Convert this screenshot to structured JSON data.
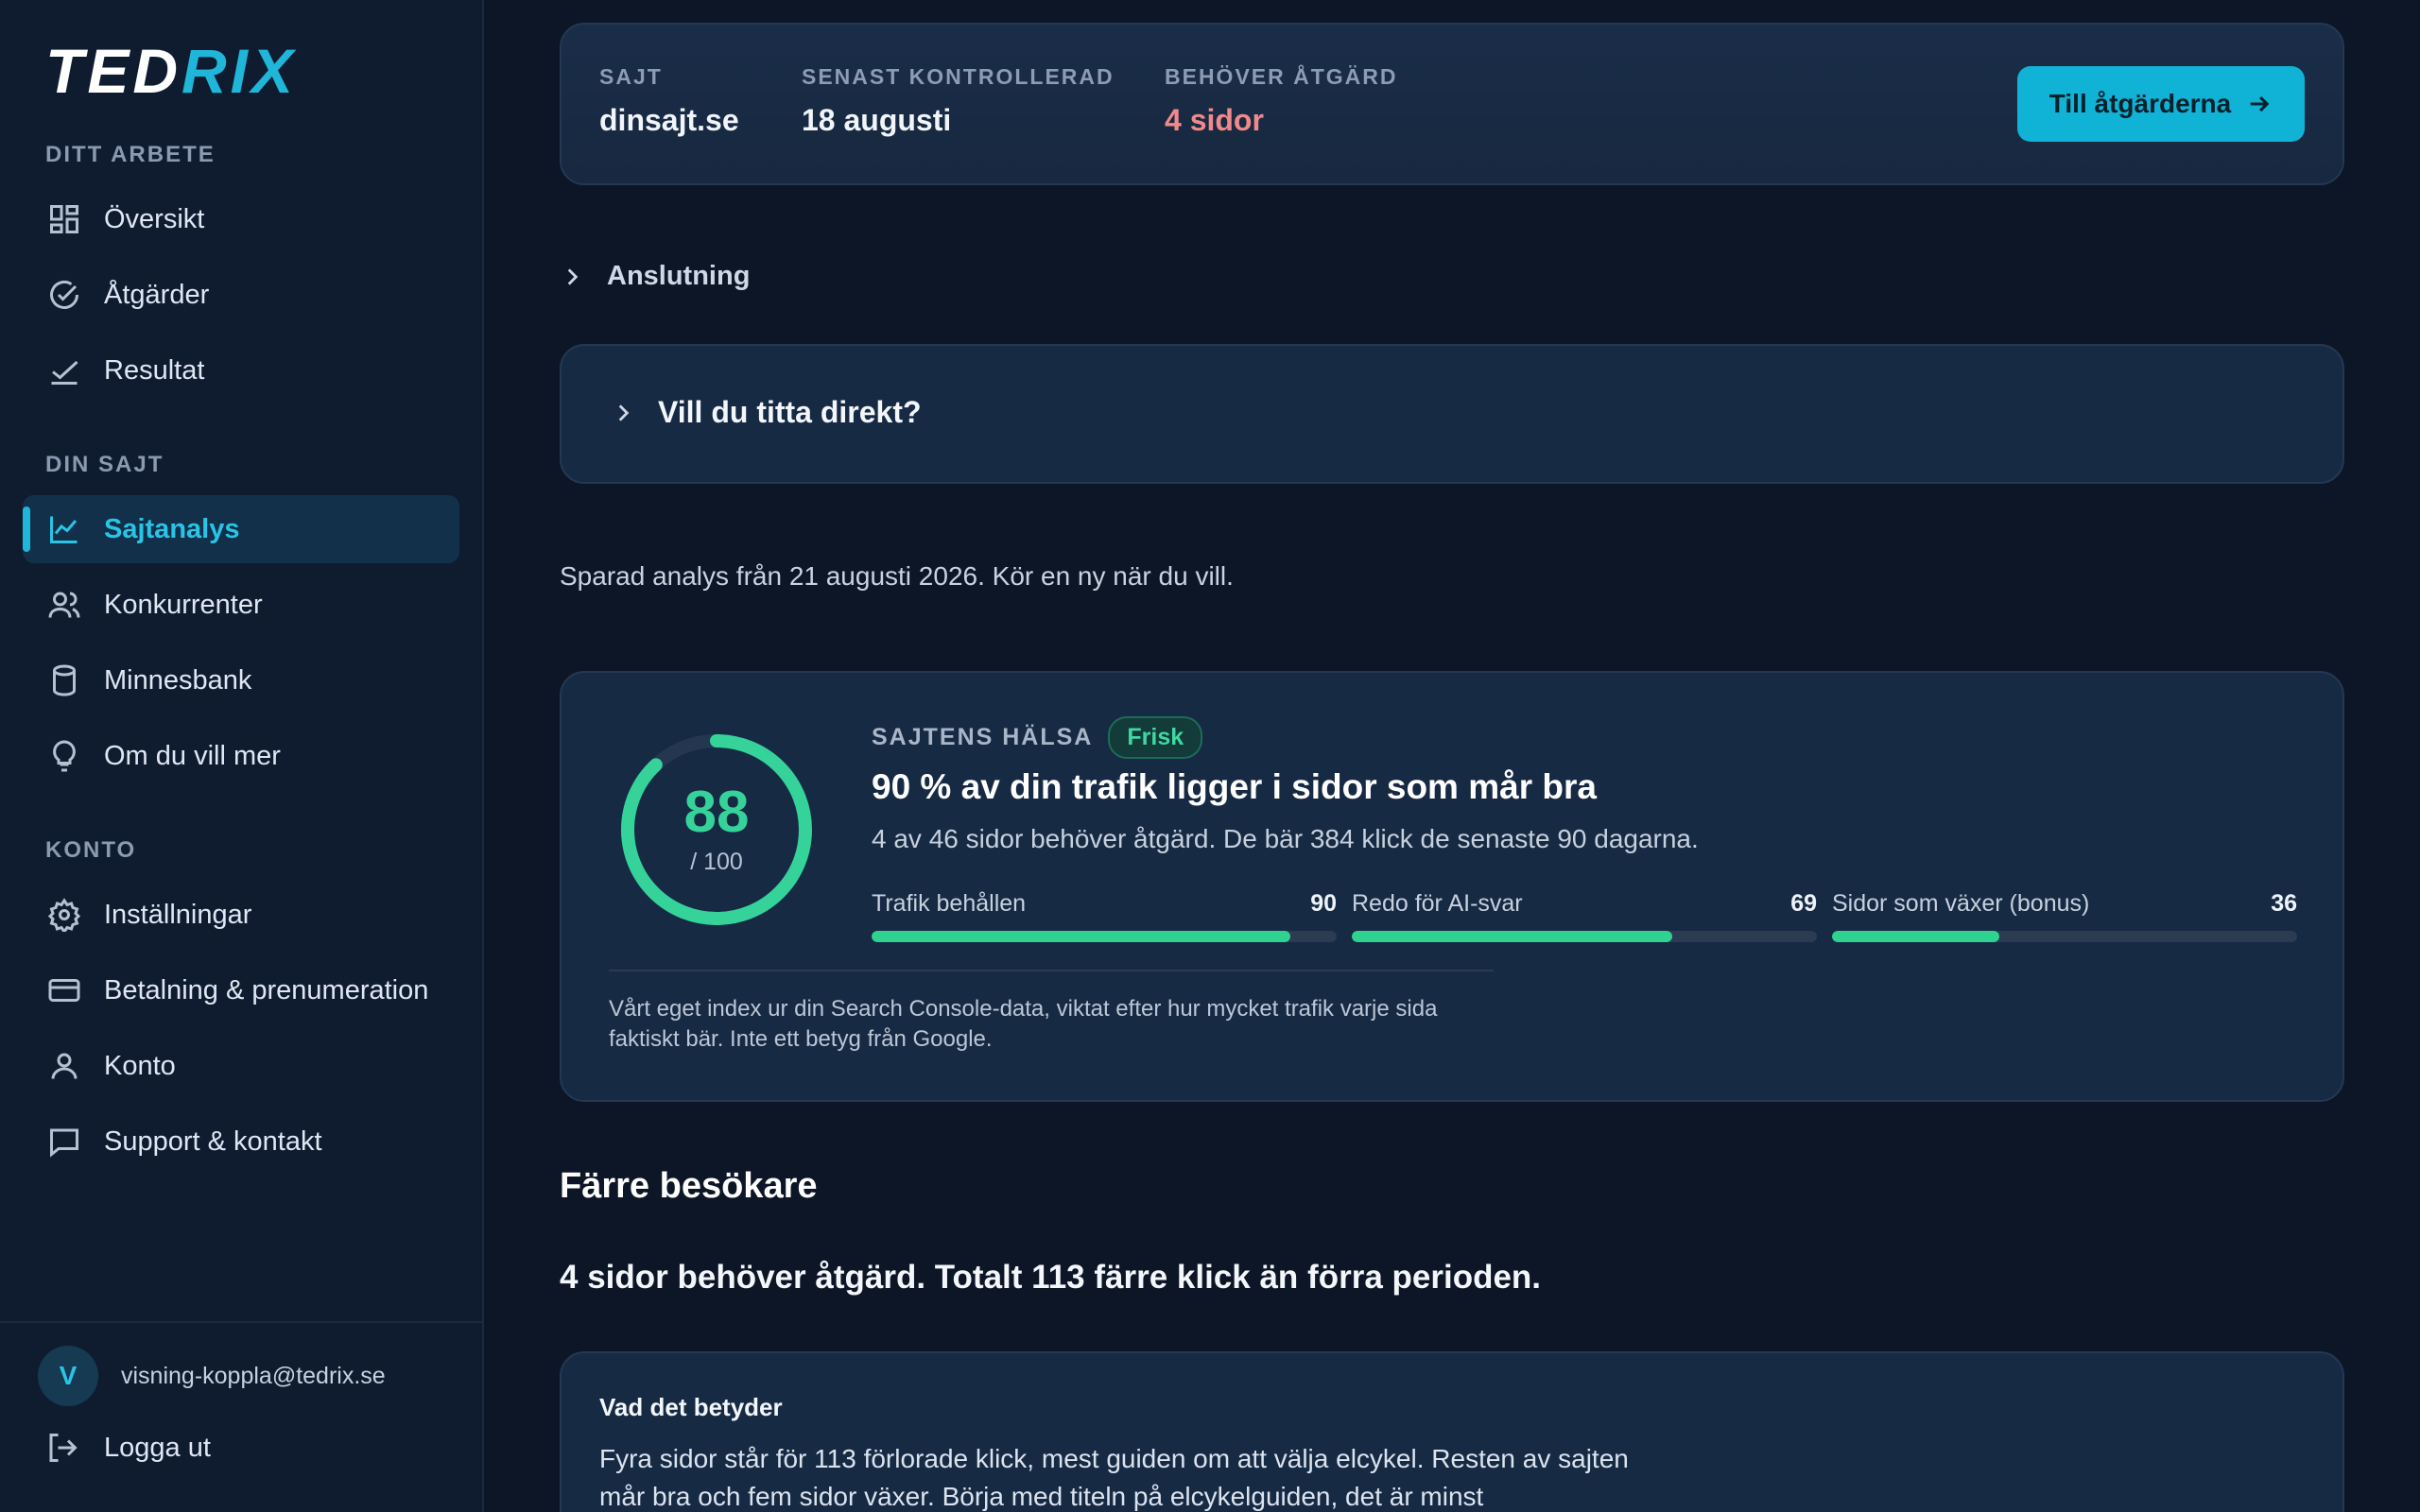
{
  "brand": {
    "part1": "TED",
    "part2": "RIX"
  },
  "sidebar": {
    "sections": {
      "work": "DITT ARBETE",
      "site": "DIN SAJT",
      "account": "KONTO"
    },
    "items": [
      {
        "label": "Översikt",
        "icon": "grid-icon"
      },
      {
        "label": "Åtgärder",
        "icon": "check-circle-icon"
      },
      {
        "label": "Resultat",
        "icon": "checkmark-trend-icon"
      },
      {
        "label": "Sajtanalys",
        "icon": "chart-line-icon",
        "active": true
      },
      {
        "label": "Konkurrenter",
        "icon": "users-icon"
      },
      {
        "label": "Minnesbank",
        "icon": "database-icon"
      },
      {
        "label": "Om du vill mer",
        "icon": "lightbulb-icon"
      },
      {
        "label": "Inställningar",
        "icon": "gear-icon"
      },
      {
        "label": "Betalning & prenumeration",
        "icon": "credit-card-icon"
      },
      {
        "label": "Konto",
        "icon": "user-icon"
      },
      {
        "label": "Support & kontakt",
        "icon": "chat-icon"
      }
    ],
    "user": {
      "initial": "V",
      "email": "visning-koppla@tedrix.se"
    },
    "logout": "Logga ut"
  },
  "site_card": {
    "site_label": "SAJT",
    "site_value": "dinsajt.se",
    "checked_label": "SENAST KONTROLLERAD",
    "checked_value": "18 augusti",
    "action_label": "BEHÖVER ÅTGÄRD",
    "action_value": "4 sidor",
    "cta": "Till åtgärderna"
  },
  "connection": "Anslutning",
  "direct": "Vill du titta direkt?",
  "saved_note": "Sparad analys från 21 augusti 2026. Kör en ny när du vill.",
  "health": {
    "label": "SAJTENS HÄLSA",
    "badge": "Frisk",
    "score": "88",
    "score_max": "/ 100",
    "score_fraction": 0.88,
    "title": "90 % av din trafik ligger i sidor som mår bra",
    "subtitle": "4 av 46 sidor behöver åtgärd. De bär 384 klick de senaste 90 dagarna.",
    "metrics": [
      {
        "label": "Trafik behållen",
        "value": "90",
        "fraction": 0.9
      },
      {
        "label": "Redo för AI-svar",
        "value": "69",
        "fraction": 0.69
      },
      {
        "label": "Sidor som växer (bonus)",
        "value": "36",
        "fraction": 0.36
      }
    ],
    "footnote": "Vårt eget index ur din Search Console-data, viktat efter hur mycket trafik varje sida faktiskt bär. Inte ett betyg från Google.",
    "accent": "#35d39a"
  },
  "section": {
    "title": "Färre besökare",
    "subtitle": "4 sidor behöver åtgärd. Totalt 113 färre klick än förra perioden."
  },
  "meaning": {
    "title": "Vad det betyder",
    "body": "Fyra sidor står för 113 förlorade klick, mest guiden om att välja elcykel. Resten av sajten mår bra och fem sidor växer. Börja med titeln på elcykelguiden, det är minst"
  }
}
